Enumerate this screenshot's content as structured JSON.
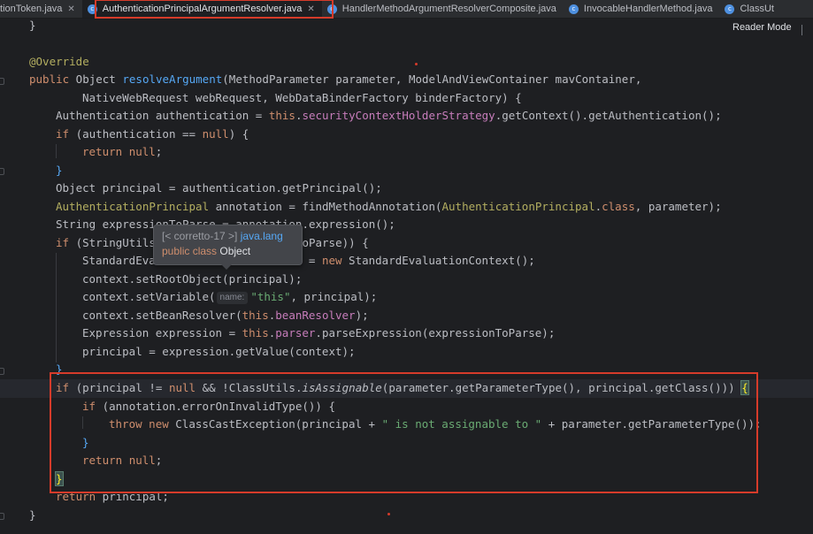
{
  "tabs": [
    {
      "label": "icationToken.java",
      "active": false,
      "closable": true
    },
    {
      "label": "AuthenticationPrincipalArgumentResolver.java",
      "active": true,
      "closable": true
    },
    {
      "label": "HandlerMethodArgumentResolverComposite.java",
      "active": false,
      "closable": false
    },
    {
      "label": "InvocableHandlerMethod.java",
      "active": false,
      "closable": false
    },
    {
      "label": "ClassUt",
      "active": false,
      "closable": false
    }
  ],
  "toolbar": {
    "reader_mode": "Reader Mode"
  },
  "tooltip": {
    "jdk": "[< corretto-17 >]",
    "package": "java.lang",
    "modifiers": "public class",
    "type": "Object"
  },
  "code": {
    "l01": {
      "a": "}"
    },
    "l02": {
      "annotation": "@Override"
    },
    "l03": {
      "kw1": "public",
      "t1": " Object ",
      "method": "resolveArgument",
      "t2": "(MethodParameter parameter, ModelAndViewContainer mavContainer,"
    },
    "l04": {
      "t1": "NativeWebRequest webRequest, WebDataBinderFactory binderFactory) {"
    },
    "l05": {
      "t1": "Authentication authentication = ",
      "kw1": "this",
      "t2": ".",
      "field": "securityContextHolderStrategy",
      "t3": ".getContext().getAuthentication();"
    },
    "l06": {
      "kw1": "if",
      "t1": " (authentication == ",
      "kw2": "null",
      "t2": ") {"
    },
    "l07": {
      "kw1": "return",
      "t1": " ",
      "kw2": "null",
      "t2": ";"
    },
    "l08": {
      "t1": "}"
    },
    "l09": {
      "t1": "Object principal = authentication.getPrincipal();"
    },
    "l10": {
      "ann": "AuthenticationPrincipal",
      "t1": " annotation = findMethodAnnotation(",
      "ann2": "AuthenticationPrincipal",
      "t2": ".",
      "kw1": "class",
      "t3": ", parameter);"
    },
    "l11": {
      "t1": "String expressionToParse = annotation.expression();"
    },
    "l12": {
      "kw1": "if",
      "t1": " (StringUtils.hasLength(expressionToParse)) {"
    },
    "l13": {
      "t1": "StandardEvaluationContext context = ",
      "kw1": "new",
      "t2": " StandardEvaluationContext();"
    },
    "l14": {
      "t1": "context.setRootObject(principal);"
    },
    "l15": {
      "t1": "context.setVariable(",
      "hint": "name:",
      "str": "\"this\"",
      "t2": ", principal);"
    },
    "l16": {
      "t1": "context.setBeanResolver(",
      "kw1": "this",
      "t2": ".",
      "field": "beanResolver",
      "t3": ");"
    },
    "l17": {
      "t1": "Expression expression = ",
      "kw1": "this",
      "t2": ".",
      "field": "parser",
      "t3": ".parseExpression(expressionToParse);"
    },
    "l18": {
      "t1": "principal = expression.getValue(context);"
    },
    "l19": {
      "t1": "}"
    },
    "l20": {
      "kw1": "if",
      "t1": " (principal != ",
      "kw2": "null",
      "t2": " && !ClassUtils.",
      "it": "isAssignable",
      "t3": "(parameter.getParameterType(), principal.getClass())) ",
      "brace": "{"
    },
    "l21": {
      "kw1": "if",
      "t1": " (annotation.errorOnInvalidType()) {"
    },
    "l22": {
      "kw1": "throw",
      "t1": " ",
      "kw2": "new",
      "t2": " ClassCastException(principal + ",
      "str": "\" is not assignable to \"",
      "t3": " + parameter.getParameterType());"
    },
    "l23": {
      "t1": "}"
    },
    "l24": {
      "kw1": "return",
      "t1": " ",
      "kw2": "null",
      "t2": ";"
    },
    "l25": {
      "brace": "}"
    },
    "l26": {
      "kw1": "return",
      "t1": " principal;"
    },
    "l27": {
      "t1": "}"
    }
  },
  "colors": {
    "background": "#1e1f22",
    "keyword": "#cf8e6d",
    "method": "#56a8f5",
    "annotation": "#b3ae60",
    "field": "#c77dbb",
    "string": "#6aab73",
    "highlight_box": "#d63b2a"
  }
}
